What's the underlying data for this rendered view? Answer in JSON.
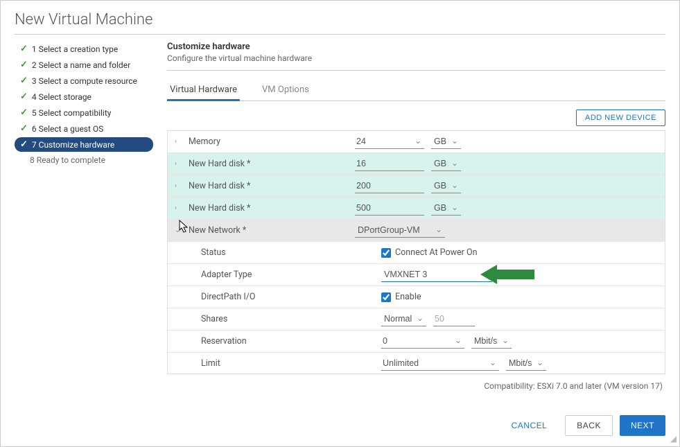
{
  "title": "New Virtual Machine",
  "steps": [
    {
      "label": "1 Select a creation type",
      "state": "done"
    },
    {
      "label": "2 Select a name and folder",
      "state": "done"
    },
    {
      "label": "3 Select a compute resource",
      "state": "done"
    },
    {
      "label": "4 Select storage",
      "state": "done"
    },
    {
      "label": "5 Select compatibility",
      "state": "done"
    },
    {
      "label": "6 Select a guest OS",
      "state": "done"
    },
    {
      "label": "7 Customize hardware",
      "state": "current"
    },
    {
      "label": "8 Ready to complete",
      "state": "pending"
    }
  ],
  "section": {
    "title": "Customize hardware",
    "desc": "Configure the virtual machine hardware"
  },
  "tabs": {
    "hw": "Virtual Hardware",
    "options": "VM Options"
  },
  "toolbar": {
    "add": "ADD NEW DEVICE"
  },
  "hw": {
    "memory": {
      "label": "Memory",
      "value": "24",
      "unit": "GB"
    },
    "disk1": {
      "label": "New Hard disk *",
      "value": "16",
      "unit": "GB"
    },
    "disk2": {
      "label": "New Hard disk *",
      "value": "200",
      "unit": "GB"
    },
    "disk3": {
      "label": "New Hard disk *",
      "value": "500",
      "unit": "GB"
    },
    "network": {
      "label": "New Network *",
      "value": "DPortGroup-VM"
    },
    "status": {
      "label": "Status",
      "checked": true,
      "text": "Connect At Power On"
    },
    "adapter": {
      "label": "Adapter Type",
      "value": "VMXNET 3"
    },
    "directpath": {
      "label": "DirectPath I/O",
      "checked": true,
      "text": "Enable"
    },
    "shares": {
      "label": "Shares",
      "value": "Normal",
      "num": "50"
    },
    "reservation": {
      "label": "Reservation",
      "value": "0",
      "unit": "Mbit/s"
    },
    "limit": {
      "label": "Limit",
      "value": "Unlimited",
      "unit": "Mbit/s"
    }
  },
  "compat": "Compatibility: ESXi 7.0 and later (VM version 17)",
  "footer": {
    "cancel": "CANCEL",
    "back": "BACK",
    "next": "NEXT"
  }
}
